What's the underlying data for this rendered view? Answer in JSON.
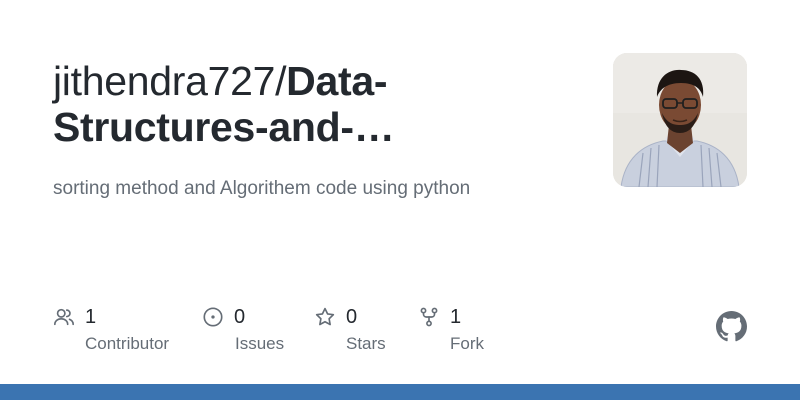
{
  "repo": {
    "owner": "jithendra727/",
    "name_line1": "Data-",
    "name_line2": "Structures-and-…",
    "description": "sorting method and Algorithem code using python"
  },
  "stats": {
    "contributors": {
      "count": "1",
      "label": "Contributor",
      "icon": "people-icon"
    },
    "issues": {
      "count": "0",
      "label": "Issues",
      "icon": "issue-opened-icon"
    },
    "stars": {
      "count": "0",
      "label": "Stars",
      "icon": "star-icon"
    },
    "forks": {
      "count": "1",
      "label": "Fork",
      "icon": "repo-forked-icon"
    }
  },
  "avatar": {
    "alt": "avatar"
  },
  "icons": {
    "brand": "github-mark-icon"
  },
  "colors": {
    "title": "#24292f",
    "muted": "#656d76",
    "footer_bar": "#3b74b1",
    "icon": "#656d76"
  }
}
